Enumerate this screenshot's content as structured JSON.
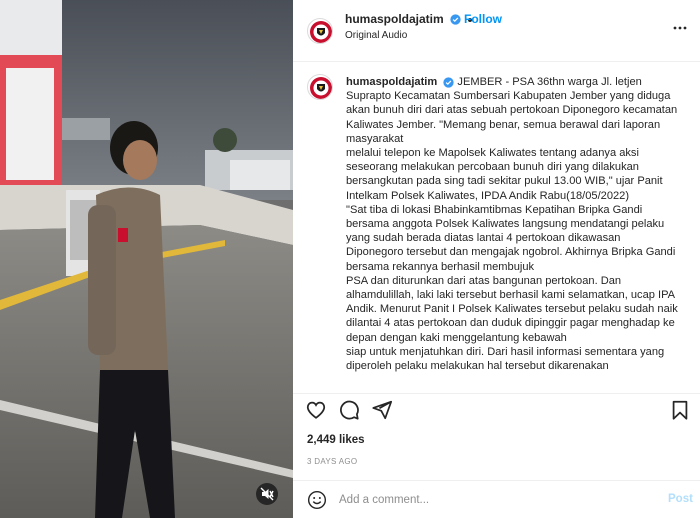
{
  "post": {
    "username": "humaspoldajatim",
    "follow_label": "Follow",
    "audio_label": "Original Audio"
  },
  "caption": {
    "username": "humaspoldajatim",
    "text": "JEMBER - PSA 36thn warga Jl. letjen\nSuprapto Kecamatan Sumbersari Kabupaten Jember yang diduga\nakan bunuh diri dari atas sebuah pertokoan Diponegoro kecamatan\nKaliwates Jember. \"Memang benar, semua berawal dari laporan\nmasyarakat\nmelalui telepon ke Mapolsek Kaliwates tentang adanya aksi\nseseorang melakukan percobaan bunuh diri yang dilakukan\nbersangkutan pada sing tadi sekitar pukul 13.00 WIB,\" ujar Panit\nIntelkam Polsek Kaliwates, IPDA Andik Rabu(18/05/2022)\n\"Sat tiba di lokasi Bhabinkamtibmas Kepatihan Bripka Gandi\nbersama anggota Polsek Kaliwates langsung mendatangi pelaku\nyang sudah berada diatas lantai 4 pertokoan dikawasan\nDiponegoro tersebut dan mengajak ngobrol. Akhirnya Bripka Gandi\nbersama rekannya berhasil membujuk\nPSA dan diturunkan dari atas bangunan pertokoan. Dan\nalhamdulillah, laki laki tersebut berhasil kami selamatkan, ucap IPA\nAndik. Menurut Panit I Polsek Kaliwates tersebut pelaku sudah naik\ndilantai 4 atas pertokoan dan duduk dipinggir pagar menghadap ke\ndepan dengan kaki menggelantung kebawah\nsiap untuk menjatuhkan diri. Dari hasil informasi sementara yang\ndiperoleh pelaku melakukan hal tersebut dikarenakan"
  },
  "stats": {
    "likes": "2,449 likes",
    "posted_ago": "3 DAYS AGO"
  },
  "comment_box": {
    "placeholder": "Add a comment...",
    "post_label": "Post"
  },
  "icons": {
    "avatar": "police-emblem-icon",
    "verified": "verified-badge-icon",
    "more": "more-options-icon",
    "like": "heart-icon",
    "comment": "comment-icon",
    "share": "send-icon",
    "save": "bookmark-icon",
    "emoji": "emoji-icon",
    "mute": "speaker-muted-icon"
  },
  "colors": {
    "accent": "#0095f6",
    "verified": "#3897f0",
    "post_disabled": "#b2dffc",
    "emblem_red": "#c8102e"
  }
}
